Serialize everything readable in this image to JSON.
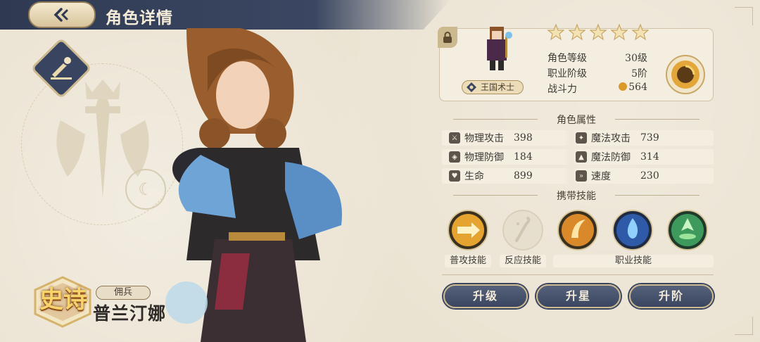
{
  "header": {
    "title": "角色详情"
  },
  "character": {
    "rarity": "史诗",
    "role": "佣兵",
    "name": "普兰汀娜",
    "class_name": "王国术士",
    "stars": 5
  },
  "info": {
    "level_label": "角色等级",
    "level_value": "30级",
    "rank_label": "职业阶级",
    "rank_value": "5阶",
    "power_label": "战斗力",
    "power_value": "564"
  },
  "attributes": {
    "title": "角色属性",
    "items": [
      {
        "label": "物理攻击",
        "value": "398",
        "icon": "sword-icon"
      },
      {
        "label": "魔法攻击",
        "value": "739",
        "icon": "wand-icon"
      },
      {
        "label": "物理防御",
        "value": "184",
        "icon": "shield-icon"
      },
      {
        "label": "魔法防御",
        "value": "314",
        "icon": "hat-icon"
      },
      {
        "label": "生命",
        "value": "899",
        "icon": "heart-icon"
      },
      {
        "label": "速度",
        "value": "230",
        "icon": "boot-icon"
      }
    ]
  },
  "skills": {
    "title": "携带技能",
    "labels": {
      "normal": "普攻技能",
      "reaction": "反应技能",
      "class": "职业技能"
    }
  },
  "actions": {
    "level_up": "升级",
    "star_up": "升星",
    "rank_up": "升阶"
  },
  "colors": {
    "accent_navy": "#3a4560",
    "gold": "#cdb98f",
    "panel": "#f4eee1"
  }
}
